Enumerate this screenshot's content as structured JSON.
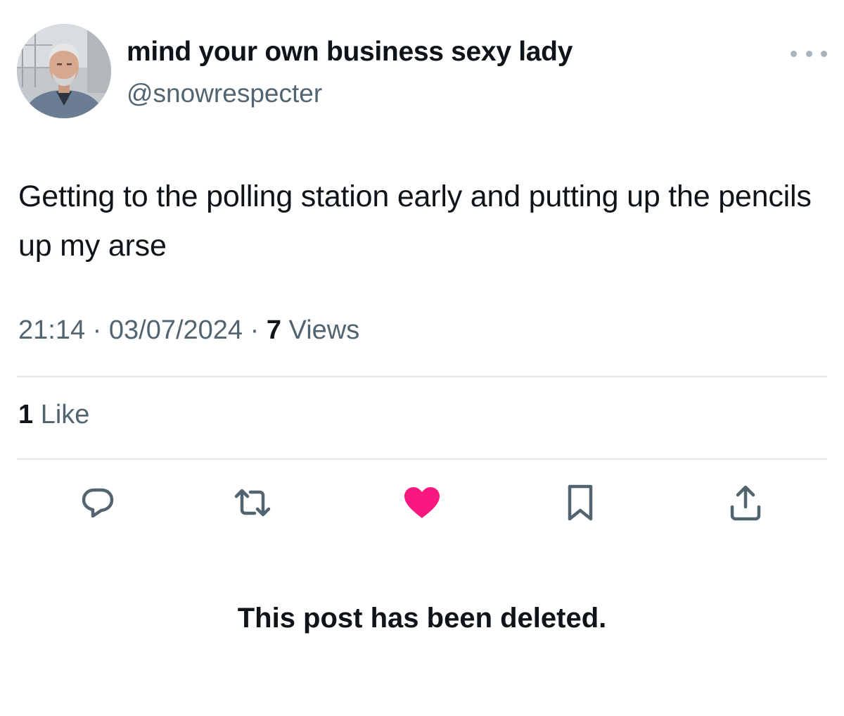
{
  "post": {
    "author": {
      "display_name": "mind your own business sexy lady",
      "handle": "@snowrespecter"
    },
    "text": "Getting to the polling station early and putting up the pencils up my arse",
    "time": "21:14",
    "date": "03/07/2024",
    "views_count": "7",
    "views_label": "Views",
    "likes_count": "1",
    "likes_label": "Like"
  },
  "icons": {
    "more": "more-horizontal-icon",
    "reply": "reply-icon",
    "repost": "repost-icon",
    "like": "heart-icon",
    "bookmark": "bookmark-icon",
    "share": "share-icon"
  },
  "colors": {
    "text_primary": "#0f1419",
    "text_secondary": "#536471",
    "like_active": "#f91880",
    "divider": "#e3e7ea"
  },
  "notice": "This post has been deleted."
}
